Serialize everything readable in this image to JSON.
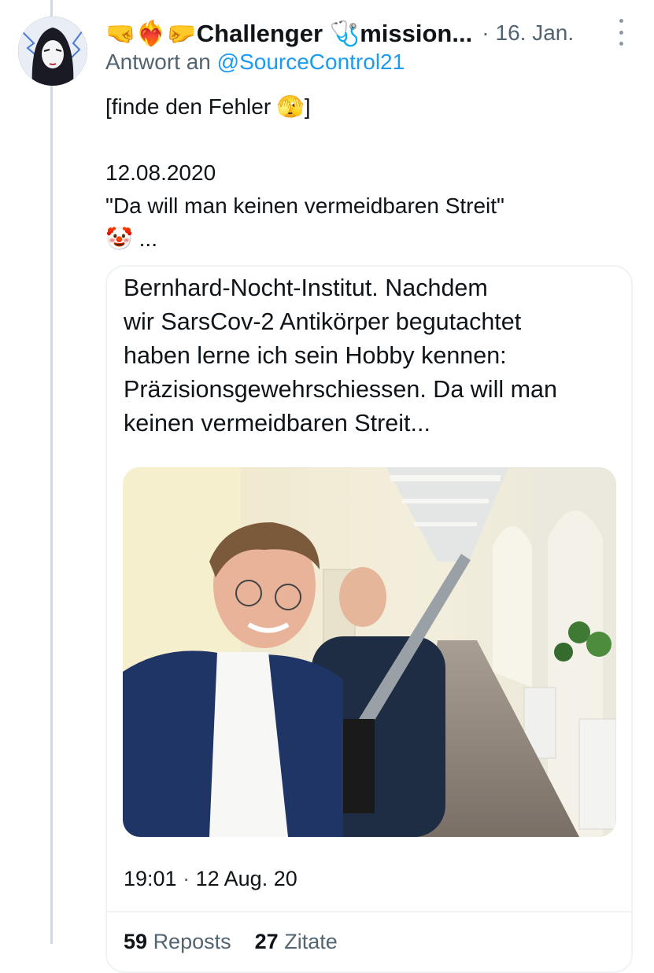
{
  "tweet": {
    "display_name": "🤜❤️‍🔥🤛Challenger 🩺mission...",
    "separator": "·",
    "date": "16. Jan.",
    "reply_prefix": "Antwort an",
    "reply_handle": "@SourceControl21",
    "body_lines": [
      "[finde den Fehler 🫣]",
      "",
      "12.08.2020",
      "\"Da will man keinen vermeidbaren Streit\"",
      "🤡 ..."
    ]
  },
  "quoted": {
    "text_lines": [
      "Bernhard-Nocht-Institut. Nachdem",
      "wir SarsCov-2 Antikörper begutachtet",
      "haben lerne ich sein Hobby kennen:",
      "Präzisionsgewehrschiessen. Da will man",
      "keinen vermeidbaren Streit..."
    ],
    "time": "19:01",
    "separator": "·",
    "date": "12 Aug. 20",
    "stats": {
      "reposts_count": "59",
      "reposts_label": "Reposts",
      "quotes_count": "27",
      "quotes_label": "Zitate"
    }
  },
  "icons": {
    "more": "more-dots-icon",
    "avatar": "avatar-image"
  },
  "colors": {
    "link": "#1d9bf0",
    "secondary": "#536471",
    "border": "#eff3f4",
    "thread": "#cfd9de"
  }
}
